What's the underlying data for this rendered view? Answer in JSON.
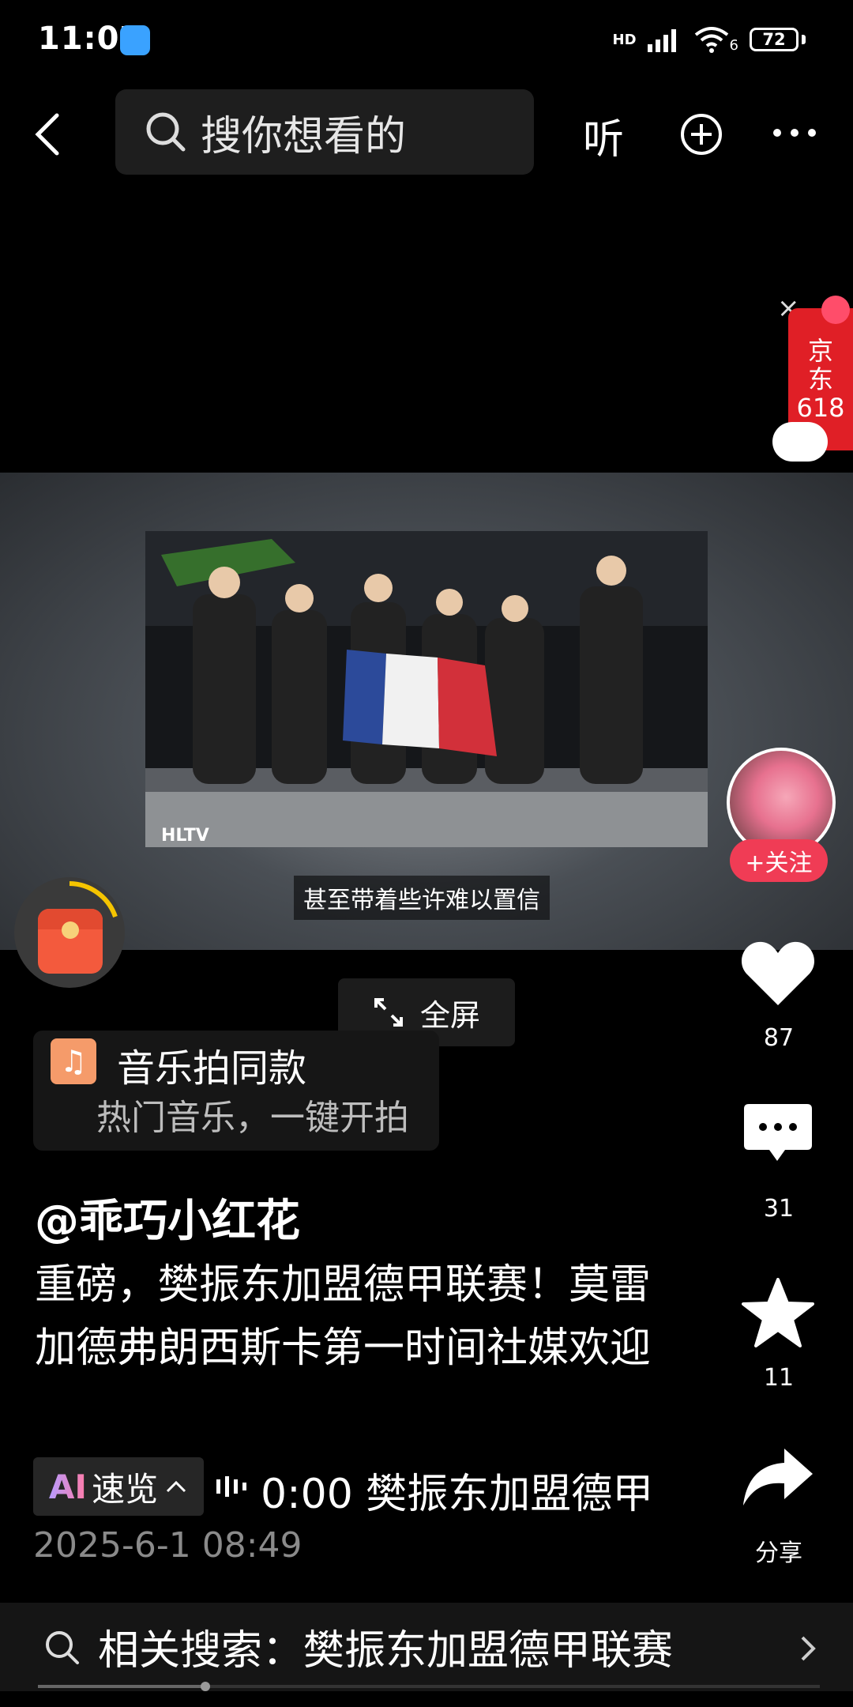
{
  "status_bar": {
    "time": "11:07",
    "battery": "72",
    "network": "HD",
    "wifi_index": "6"
  },
  "top_bar": {
    "search_placeholder": "搜你想看的",
    "listen_label": "听"
  },
  "ad": {
    "brand_line1": "京",
    "brand_line2": "东",
    "promo": "618",
    "close_symbol": "×"
  },
  "video": {
    "subtitle": "甚至带着些许难以置信",
    "watermark": "HLTV"
  },
  "fullscreen_label": "全屏",
  "music": {
    "title": "音乐拍同款",
    "subtitle": "热门音乐，一键开拍"
  },
  "post": {
    "author": "@乖巧小红花",
    "description": "重磅，樊振东加盟德甲联赛！莫雷加德弗朗西斯卡第一时间社媒欢迎",
    "ai_label": "速览",
    "ai_mark": "AI",
    "ai_preview": "0:00 樊振东加盟德甲",
    "date": "2025-6-1 08:49"
  },
  "actions": {
    "follow_label": "+关注",
    "likes": "87",
    "comments": "31",
    "favorites": "11",
    "share_label": "分享"
  },
  "related_search": {
    "text": "相关搜索：樊振东加盟德甲联赛"
  },
  "colors": {
    "accent_red": "#f03c55",
    "jd_red": "#e01f26",
    "music_orange": "#f59b6a"
  },
  "icons": [
    "back-icon",
    "search-icon",
    "plus-circle-icon",
    "more-icon",
    "heart-icon",
    "comment-icon",
    "star-icon",
    "share-icon",
    "chevron-right-icon",
    "expand-icon",
    "music-note-icon",
    "red-packet-icon"
  ]
}
